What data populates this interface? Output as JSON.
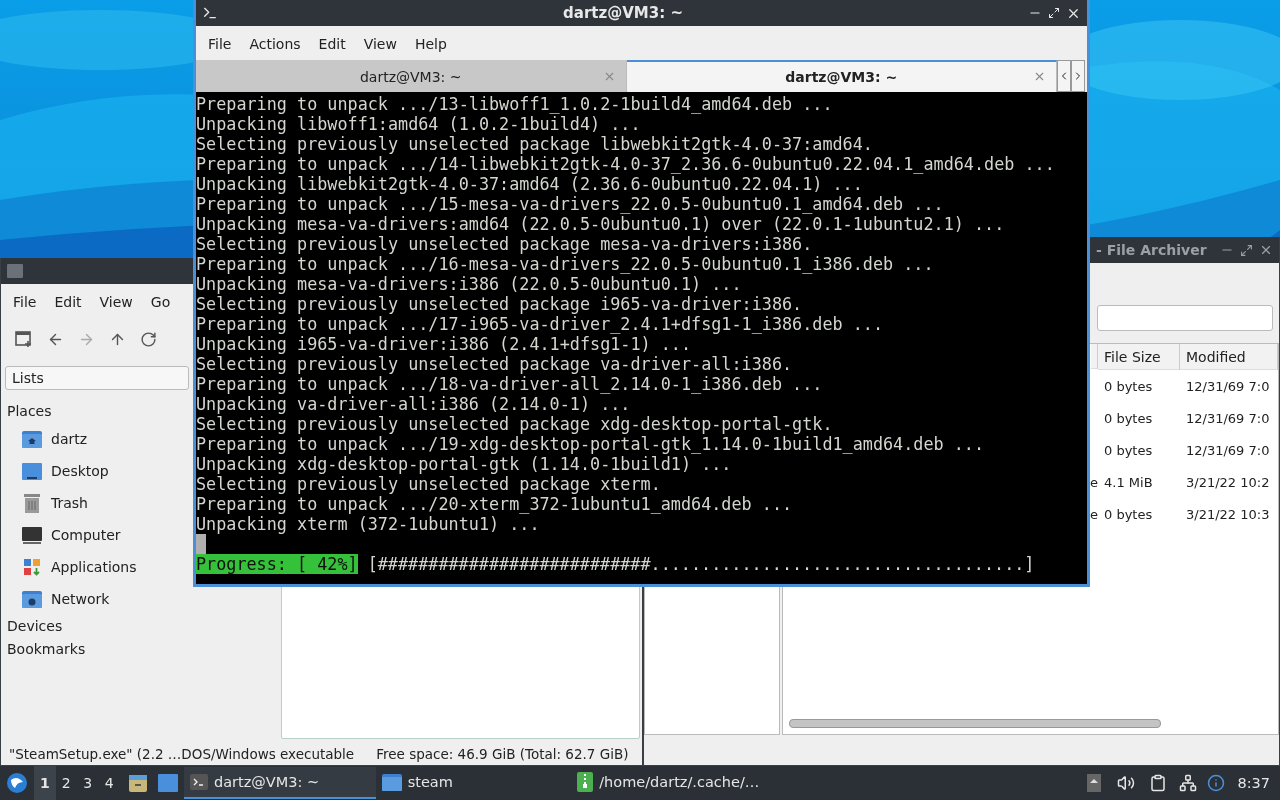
{
  "terminal": {
    "title": "dartz@VM3: ~",
    "menu": [
      "File",
      "Actions",
      "Edit",
      "View",
      "Help"
    ],
    "tabs": [
      {
        "label": "dartz@VM3: ~",
        "selected": false
      },
      {
        "label": "dartz@VM3: ~",
        "selected": true
      }
    ],
    "lines": [
      "Preparing to unpack .../13-libwoff1_1.0.2-1build4_amd64.deb ...",
      "Unpacking libwoff1:amd64 (1.0.2-1build4) ...",
      "Selecting previously unselected package libwebkit2gtk-4.0-37:amd64.",
      "Preparing to unpack .../14-libwebkit2gtk-4.0-37_2.36.6-0ubuntu0.22.04.1_amd64.deb ...",
      "Unpacking libwebkit2gtk-4.0-37:amd64 (2.36.6-0ubuntu0.22.04.1) ...",
      "Preparing to unpack .../15-mesa-va-drivers_22.0.5-0ubuntu0.1_amd64.deb ...",
      "Unpacking mesa-va-drivers:amd64 (22.0.5-0ubuntu0.1) over (22.0.1-1ubuntu2.1) ...",
      "Selecting previously unselected package mesa-va-drivers:i386.",
      "Preparing to unpack .../16-mesa-va-drivers_22.0.5-0ubuntu0.1_i386.deb ...",
      "Unpacking mesa-va-drivers:i386 (22.0.5-0ubuntu0.1) ...",
      "Selecting previously unselected package i965-va-driver:i386.",
      "Preparing to unpack .../17-i965-va-driver_2.4.1+dfsg1-1_i386.deb ...",
      "Unpacking i965-va-driver:i386 (2.4.1+dfsg1-1) ...",
      "Selecting previously unselected package va-driver-all:i386.",
      "Preparing to unpack .../18-va-driver-all_2.14.0-1_i386.deb ...",
      "Unpacking va-driver-all:i386 (2.14.0-1) ...",
      "Selecting previously unselected package xdg-desktop-portal-gtk.",
      "Preparing to unpack .../19-xdg-desktop-portal-gtk_1.14.0-1build1_amd64.deb ...",
      "Unpacking xdg-desktop-portal-gtk (1.14.0-1build1) ...",
      "Selecting previously unselected package xterm.",
      "Preparing to unpack .../20-xterm_372-1ubuntu1_amd64.deb ...",
      "Unpacking xterm (372-1ubuntu1) ..."
    ],
    "progress": {
      "label": "Progress: [ 42%]",
      "bar": "[###########################.....................................]"
    }
  },
  "file_manager": {
    "menu": [
      "File",
      "Edit",
      "View",
      "Go"
    ],
    "toolbar": [
      {
        "kind": "new-tab",
        "disabled": false
      },
      {
        "kind": "back",
        "disabled": false
      },
      {
        "kind": "forward",
        "disabled": true
      },
      {
        "kind": "up",
        "disabled": false
      },
      {
        "kind": "reload",
        "disabled": false
      }
    ],
    "side_pane": "Lists",
    "sections": [
      {
        "title": "Places",
        "items": [
          {
            "label": "dartz",
            "kind": "home"
          },
          {
            "label": "Desktop",
            "kind": "desktop"
          },
          {
            "label": "Trash",
            "kind": "trash"
          },
          {
            "label": "Computer",
            "kind": "computer"
          },
          {
            "label": "Applications",
            "kind": "applications"
          },
          {
            "label": "Network",
            "kind": "network"
          }
        ]
      },
      {
        "title": "Devices"
      },
      {
        "title": "Bookmarks"
      }
    ],
    "status": [
      "\"SteamSetup.exe\" (2.2 …DOS/Windows executable",
      "Free space: 46.9 GiB (Total: 62.7 GiB)"
    ]
  },
  "archiver": {
    "title": "- File Archiver",
    "columns": [
      "File Size",
      "Modified"
    ],
    "rows": [
      {
        "size": "0 bytes",
        "modified": "12/31/69 7:0"
      },
      {
        "size": "0 bytes",
        "modified": "12/31/69 7:0"
      },
      {
        "size": "0 bytes",
        "modified": "12/31/69 7:0"
      },
      {
        "name": "e",
        "size": "4.1 MiB",
        "modified": "3/21/22 10:2"
      },
      {
        "name": "e",
        "size": "0 bytes",
        "modified": "3/21/22 10:3"
      }
    ]
  },
  "taskbar": {
    "workspaces": [
      {
        "label": "1",
        "selected": true
      },
      {
        "label": "2",
        "selected": false
      },
      {
        "label": "3",
        "selected": false
      },
      {
        "label": "4",
        "selected": false
      }
    ],
    "tasks": [
      {
        "label": "dartz@VM3: ~",
        "kind": "terminal",
        "selected": true
      },
      {
        "label": "steam",
        "kind": "folder",
        "selected": false
      },
      {
        "label": "/home/dartz/.cache/…",
        "kind": "archive",
        "selected": false
      }
    ],
    "clock": "8:37"
  }
}
